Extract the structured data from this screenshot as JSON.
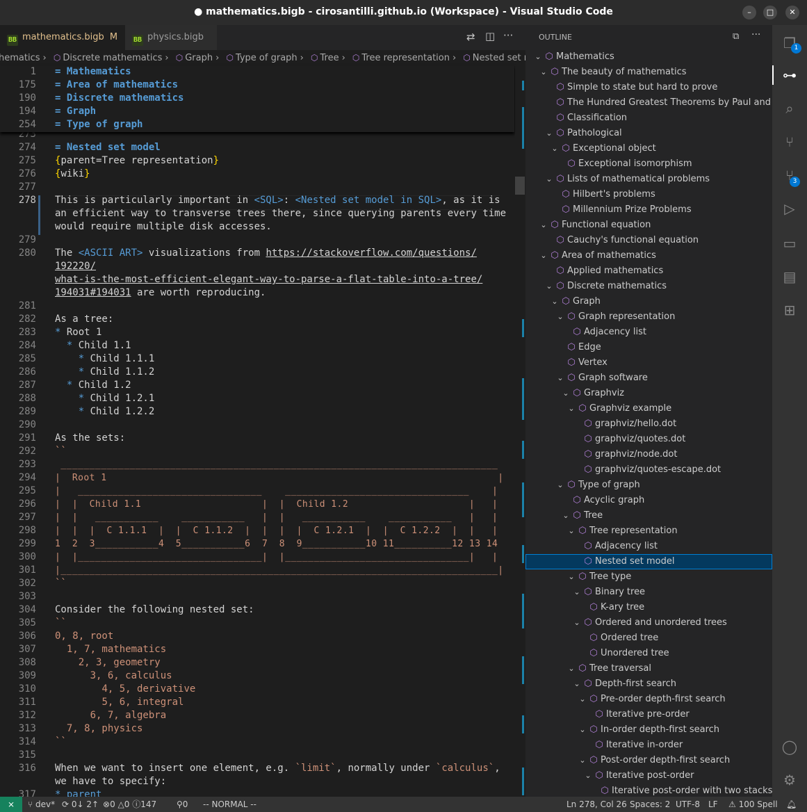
{
  "window": {
    "title": "● mathematics.bigb - cirosantilli.github.io (Workspace) - Visual Studio Code"
  },
  "tabs": [
    {
      "icon": "bigb-file-icon",
      "label": "mathematics.bigb",
      "status": "M",
      "dirty": "●"
    },
    {
      "icon": "bigb-file-icon",
      "label": "physics.bigb"
    }
  ],
  "breadcrumb": [
    "hematics",
    "Discrete mathematics",
    "Graph",
    "Type of graph",
    "Tree",
    "Tree representation",
    "Nested set model"
  ],
  "sticky_lines": [
    {
      "ln": "1",
      "text": "= Mathematics"
    },
    {
      "ln": "175",
      "text": "= Area of mathematics"
    },
    {
      "ln": "190",
      "text": "= Discrete mathematics"
    },
    {
      "ln": "194",
      "text": "= Graph"
    },
    {
      "ln": "254",
      "text": "= Type of graph"
    }
  ],
  "editor": {
    "line_numbers": [
      "273",
      "274",
      "275",
      "276",
      "277",
      "278",
      "",
      "",
      "279",
      "280",
      "",
      "",
      "",
      "281",
      "282",
      "283",
      "284",
      "285",
      "286",
      "287",
      "288",
      "289",
      "290",
      "291",
      "292",
      "293",
      "294",
      "295",
      "296",
      "297",
      "298",
      "299",
      "300",
      "301",
      "302",
      "303",
      "304",
      "305",
      "306",
      "307",
      "308",
      "309",
      "310",
      "311",
      "312",
      "313",
      "314",
      "315",
      "316",
      "",
      "317"
    ],
    "current_line": "278",
    "l274": "= Nested set model",
    "l275a": "{",
    "l275b": "parent=Tree representation",
    "l275c": "}",
    "l276a": "{",
    "l276b": "wiki",
    "l276c": "}",
    "l278a": "This is particularly important in ",
    "l278b": "<SQL>",
    "l278c": ": ",
    "l278d": "<Nested set model in SQL>",
    "l278e": ", as it is",
    "l278f": "an efficient way to transverse trees there, since querying parents every time",
    "l278g": "would require multiple disk accesses.",
    "l280a": "The ",
    "l280b": "<ASCII ART>",
    "l280c": " visualizations from ",
    "l280d": "https://stackoverflow.com/questions/",
    "l280e": "192220/",
    "l280f": "what-is-the-most-efficient-elegant-way-to-parse-a-flat-table-into-a-tree/",
    "l280g": "194031#194031",
    "l280h": " are worth reproducing.",
    "l282": "As a tree:",
    "tree": [
      {
        "indent": "",
        "text": "Root 1"
      },
      {
        "indent": "  ",
        "text": "Child 1.1"
      },
      {
        "indent": "    ",
        "text": "Child 1.1.1"
      },
      {
        "indent": "    ",
        "text": "Child 1.1.2"
      },
      {
        "indent": "  ",
        "text": "Child 1.2"
      },
      {
        "indent": "    ",
        "text": "Child 1.2.1"
      },
      {
        "indent": "    ",
        "text": "Child 1.2.2"
      }
    ],
    "l291": "As the sets:",
    "l292": "``",
    "ascii_art": [
      " ____________________________________________________________________________",
      "|  Root 1                                                                    |",
      "|   ________________________________    ________________________________    |",
      "|  |  Child 1.1                     |  |  Child 1.2                     |   |",
      "|  |   ___________    ___________   |  |   ___________    ___________   |   |",
      "|  |  |  C 1.1.1  |  |  C 1.1.2  |  |  |  |  C 1.2.1  |  |  C 1.2.2  |  |   |",
      "1  2  3___________4  5___________6  7  8  9___________10 11__________12 13 14",
      "|  |________________________________|  |________________________________|   |",
      "|____________________________________________________________________________|"
    ],
    "l302": "``",
    "l304": "Consider the following nested set:",
    "l305": "``",
    "nested": [
      {
        "indent": "",
        "text": "0, 8, root"
      },
      {
        "indent": "  ",
        "text": "1, 7, mathematics"
      },
      {
        "indent": "    ",
        "text": "2, 3, geometry"
      },
      {
        "indent": "      ",
        "text": "3, 6, calculus"
      },
      {
        "indent": "        ",
        "text": "4, 5, derivative"
      },
      {
        "indent": "        ",
        "text": "5, 6, integral"
      },
      {
        "indent": "      ",
        "text": "6, 7, algebra"
      },
      {
        "indent": "  ",
        "text": "7, 8, physics"
      }
    ],
    "l314": "``",
    "l316a": "When we want to insert one element, e.g. ",
    "l316b": "`limit`",
    "l316c": ", normally under ",
    "l316d": "`calculus`",
    "l316e": ",",
    "l316f": "we have to specify:",
    "l317": "* parent"
  },
  "outline": {
    "header": "OUTLINE",
    "selected": "Nested set model",
    "items": [
      {
        "depth": 0,
        "chev": "v",
        "label": "Mathematics"
      },
      {
        "depth": 1,
        "chev": "v",
        "label": "The beauty of mathematics"
      },
      {
        "depth": 2,
        "chev": "",
        "label": "Simple to state but hard to prove"
      },
      {
        "depth": 2,
        "chev": "",
        "label": "The Hundred Greatest Theorems by Paul and Ja..."
      },
      {
        "depth": 2,
        "chev": "",
        "label": "Classification"
      },
      {
        "depth": 2,
        "chev": "v",
        "label": "Pathological"
      },
      {
        "depth": 3,
        "chev": "v",
        "label": "Exceptional object"
      },
      {
        "depth": 4,
        "chev": "",
        "label": "Exceptional isomorphism"
      },
      {
        "depth": 2,
        "chev": "v",
        "label": "Lists of mathematical problems"
      },
      {
        "depth": 3,
        "chev": "",
        "label": "Hilbert's problems"
      },
      {
        "depth": 3,
        "chev": "",
        "label": "Millennium Prize Problems"
      },
      {
        "depth": 1,
        "chev": "v",
        "label": "Functional equation"
      },
      {
        "depth": 2,
        "chev": "",
        "label": "Cauchy's functional equation"
      },
      {
        "depth": 1,
        "chev": "v",
        "label": "Area of mathematics"
      },
      {
        "depth": 2,
        "chev": "",
        "label": "Applied mathematics"
      },
      {
        "depth": 2,
        "chev": "v",
        "label": "Discrete mathematics"
      },
      {
        "depth": 3,
        "chev": "v",
        "label": "Graph"
      },
      {
        "depth": 4,
        "chev": "v",
        "label": "Graph representation"
      },
      {
        "depth": 5,
        "chev": "",
        "label": "Adjacency list"
      },
      {
        "depth": 4,
        "chev": "",
        "label": "Edge"
      },
      {
        "depth": 4,
        "chev": "",
        "label": "Vertex"
      },
      {
        "depth": 4,
        "chev": "v",
        "label": "Graph software"
      },
      {
        "depth": 5,
        "chev": "v",
        "label": "Graphviz"
      },
      {
        "depth": 6,
        "chev": "v",
        "label": "Graphviz example"
      },
      {
        "depth": 7,
        "chev": "",
        "label": "graphviz/hello.dot"
      },
      {
        "depth": 7,
        "chev": "",
        "label": "graphviz/quotes.dot"
      },
      {
        "depth": 7,
        "chev": "",
        "label": "graphviz/node.dot"
      },
      {
        "depth": 7,
        "chev": "",
        "label": "graphviz/quotes-escape.dot"
      },
      {
        "depth": 4,
        "chev": "v",
        "label": "Type of graph"
      },
      {
        "depth": 5,
        "chev": "",
        "label": "Acyclic graph"
      },
      {
        "depth": 5,
        "chev": "v",
        "label": "Tree"
      },
      {
        "depth": 6,
        "chev": "v",
        "label": "Tree representation"
      },
      {
        "depth": 7,
        "chev": "",
        "label": "Adjacency list"
      },
      {
        "depth": 7,
        "chev": "",
        "label": "Nested set model"
      },
      {
        "depth": 6,
        "chev": "v",
        "label": "Tree type"
      },
      {
        "depth": 7,
        "chev": "v",
        "label": "Binary tree"
      },
      {
        "depth": 8,
        "chev": "",
        "label": "K-ary tree"
      },
      {
        "depth": 7,
        "chev": "v",
        "label": "Ordered and unordered trees"
      },
      {
        "depth": 8,
        "chev": "",
        "label": "Ordered tree"
      },
      {
        "depth": 8,
        "chev": "",
        "label": "Unordered tree"
      },
      {
        "depth": 6,
        "chev": "v",
        "label": "Tree traversal"
      },
      {
        "depth": 7,
        "chev": "v",
        "label": "Depth-first search"
      },
      {
        "depth": 8,
        "chev": "v",
        "label": "Pre-order depth-first search"
      },
      {
        "depth": 9,
        "chev": "",
        "label": "Iterative pre-order"
      },
      {
        "depth": 8,
        "chev": "v",
        "label": "In-order depth-first search"
      },
      {
        "depth": 9,
        "chev": "",
        "label": "Iterative in-order"
      },
      {
        "depth": 8,
        "chev": "v",
        "label": "Post-order depth-first search"
      },
      {
        "depth": 9,
        "chev": "v",
        "label": "Iterative post-order"
      },
      {
        "depth": 10,
        "chev": "",
        "label": "Iterative post-order with two stacks"
      }
    ]
  },
  "activity": {
    "explorer_badge": "1",
    "scm_badge": "3"
  },
  "status": {
    "branch": "dev*",
    "sync": "0↓ 2↑",
    "errors": "0",
    "warnings": "0",
    "info": "147",
    "ports": "0",
    "mode": "-- NORMAL --",
    "position": "Ln 278, Col 26",
    "spaces": "Spaces: 2",
    "encoding": "UTF-8",
    "eol": "LF",
    "spell": "100 Spell"
  },
  "colors": {
    "accent": "#0078d4",
    "statusbar": "#333333",
    "remote": "#16825d",
    "cube": "#b180d7"
  }
}
